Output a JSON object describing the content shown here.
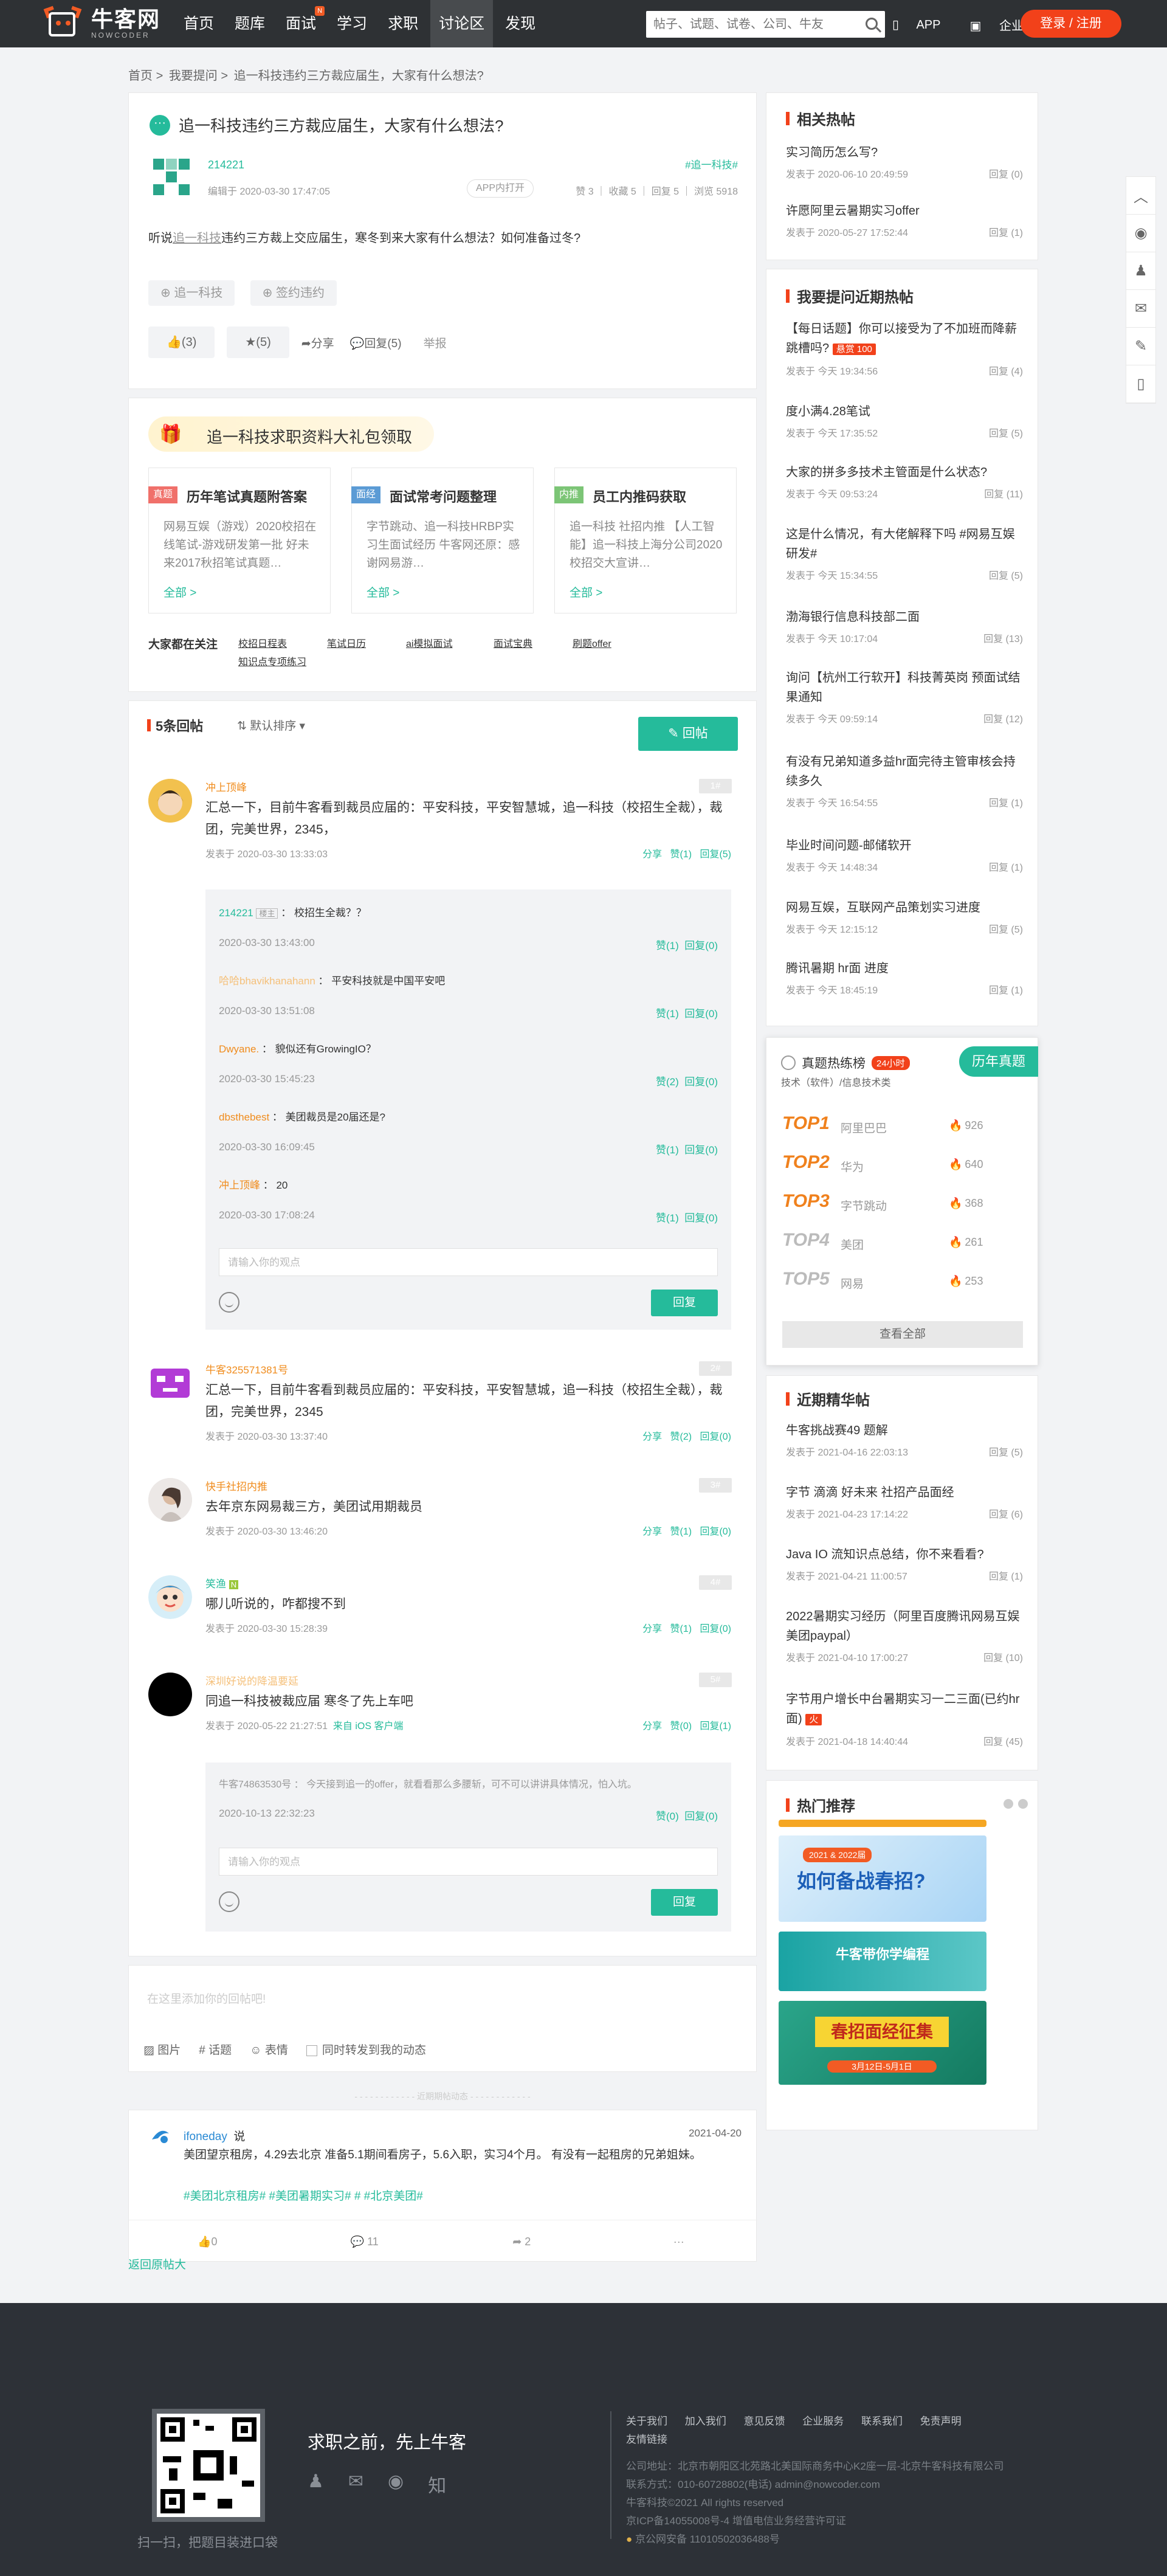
{
  "header": {
    "logo_cn": "牛客网",
    "logo_en": "NOWCODER",
    "nav": [
      {
        "label": "首页",
        "badge": ""
      },
      {
        "label": "题库",
        "badge": ""
      },
      {
        "label": "面试",
        "badge": "N"
      },
      {
        "label": "学习",
        "badge": ""
      },
      {
        "label": "求职",
        "badge": ""
      },
      {
        "label": "讨论区",
        "badge": ""
      },
      {
        "label": "发现",
        "badge": ""
      }
    ],
    "search_placeholder": "帖子、试题、试卷、公司、牛友",
    "app_label": "APP",
    "enterprise_label": "企业版",
    "login_label": "登录 / 注册"
  },
  "breadcrumb": [
    "首页",
    ">",
    "我要提问",
    ">",
    "追一科技违约三方裁应届生，大家有什么想法?"
  ],
  "post": {
    "title": "追一科技违约三方裁应届生，大家有什么想法?",
    "author": "214221",
    "edit_time": "编辑于 2020-03-30 17:47:05",
    "tag": "#追一科技#",
    "app_open": "APP内打开",
    "stats": "赞 3 ｜ 收藏 5 ｜ 回复 5 ｜ 浏览 5918",
    "body_prefix": "听说",
    "body_link": "追一科技",
    "body_suffix": "违约三方裁上交应届生，寒冬到来大家有什么想法？如何准备过冬?",
    "tags": [
      "追一科技",
      "签约违约"
    ],
    "like": "(3)",
    "star": "(5)",
    "share": "分享",
    "reply": "回复(5)",
    "report": "举报"
  },
  "gift": {
    "title": "追一科技求职资料大礼包领取",
    "cards": [
      {
        "label": "真题",
        "label_color": "#f0706a",
        "title": "历年笔试真题附答案",
        "desc": "网易互娱（游戏）2020校招在线笔试-游戏研发第一批 好未来2017秋招笔试真题…",
        "more": "全部 >"
      },
      {
        "label": "面经",
        "label_color": "#5b9bd5",
        "title": "面试常考问题整理",
        "desc": "字节跳动、追一科技HRBP实习生面试经历 牛客网还原：感谢网易游…",
        "more": "全部 >"
      },
      {
        "label": "内推",
        "label_color": "#7cc576",
        "title": "员工内推码获取",
        "desc": "追一科技 社招内推 【人工智能】追一科技上海分公司2020校招交大宣讲…",
        "more": "全部 >"
      }
    ],
    "follow_label": "大家都在关注",
    "keywords": [
      "校招日程表",
      "笔试日历",
      "ai模拟面试",
      "面试宝典",
      "刷题offer",
      "知识点专项练习"
    ]
  },
  "replies": {
    "count_label": "5条回帖",
    "sort_label": "默认排序",
    "reply_button": "回帖",
    "items": [
      {
        "nick": "冲上顶峰",
        "floor": "1#",
        "content": "汇总一下，目前牛客看到裁员应届的：平安科技，平安智慧城，追一科技（校招生全裁），裁团，完美世界，2345，",
        "time": "发表于 2020-03-30 13:33:03",
        "share": "分享",
        "likes": "赞(1)",
        "rep": "回复(5)"
      },
      {
        "nick": "牛客325571381号",
        "floor": "2#",
        "content": "汇总一下，目前牛客看到裁员应届的：平安科技，平安智慧城，追一科技（校招生全裁），裁团，完美世界，2345",
        "time": "发表于 2020-03-30 13:37:40",
        "share": "分享",
        "likes": "赞(2)",
        "rep": "回复(0)"
      },
      {
        "nick": "快手社招内推",
        "floor": "3#",
        "content": "去年京东网易裁三方，美团试用期裁员",
        "time": "发表于 2020-03-30 13:46:20",
        "share": "分享",
        "likes": "赞(1)",
        "rep": "回复(0)"
      },
      {
        "nick": "笑渔",
        "floor": "4#",
        "badge": "N",
        "content": "哪儿听说的，咋都搜不到",
        "time": "发表于 2020-03-30 15:28:39",
        "share": "分享",
        "likes": "赞(1)",
        "rep": "回复(0)"
      },
      {
        "nick": "深圳好说的降温要延",
        "floor": "5#",
        "content": "同追一科技被裁应届 寒冬了先上车吧",
        "time": "发表于 2020-05-22 21:27:51",
        "from": "来自 iOS 客户端",
        "share": "分享",
        "likes": "赞(0)",
        "rep": "回复(1)"
      }
    ],
    "sub_replies": [
      {
        "nick": "214221",
        "badge": "楼主",
        "text": "校招生全裁？？",
        "time": "2020-03-30 13:43:00",
        "likes": "赞(1)",
        "rep": "回复(0)"
      },
      {
        "nick": "哈哈bhavikhanahann",
        "badge": "",
        "text": "平安科技就是中国平安吧",
        "time": "2020-03-30 13:51:08",
        "likes": "赞(1)",
        "rep": "回复(0)"
      },
      {
        "nick": "Dwyane.",
        "badge": "",
        "text": "貌似还有GrowingIO？",
        "time": "2020-03-30 15:45:23",
        "likes": "赞(2)",
        "rep": "回复(0)"
      },
      {
        "nick": "dbsthebest",
        "badge": "",
        "text": "美团裁员是20届还是?",
        "time": "2020-03-30 16:09:45",
        "likes": "赞(1)",
        "rep": "回复(0)"
      },
      {
        "nick": "冲上顶峰",
        "badge": "",
        "text": "20",
        "time": "2020-03-30 17:08:24",
        "likes": "赞(1)",
        "rep": "回复(0)"
      }
    ],
    "sub_reply5": {
      "nick": "牛客74863530号",
      "text": "今天接到追一的offer，就看看那么多腰斩，可不可以讲讲具体情况，怕入坑。",
      "time": "2020-10-13 22:32:23",
      "likes": "赞(0)",
      "rep": "回复(0)"
    },
    "sub_placeholder": "请输入你的观点",
    "sub_reply_btn": "回复"
  },
  "composer": {
    "placeholder": "在这里添加你的回帖吧!",
    "image": "图片",
    "topic": "话题",
    "emoji": "表情",
    "repost": "同时转发到我的动态",
    "divider": "近期期帖动态"
  },
  "feed": {
    "nick": "ifoneday",
    "said": "说",
    "date": "2021-04-20",
    "text": "美团望京租房，4.29去北京 准备5.1期间看房子，5.6入职，实习4个月。 有没有一起租房的兄弟姐妹。",
    "tags": "#美团北京租房# #美团暑期实习# # #北京美团#",
    "likes": "0",
    "comments": "11",
    "shares": "2",
    "more": "···"
  },
  "back_link": "返回原帖大",
  "sidebar": {
    "hot_title": "相关热帖",
    "hot": [
      {
        "t": "实习简历怎么写?",
        "time": "发表于 2020-06-10 20:49:59",
        "rep": "回复 (0)"
      },
      {
        "t": "许愿阿里云暑期实习offer",
        "time": "发表于 2020-05-27 17:52:44",
        "rep": "回复 (1)"
      }
    ],
    "ask_title": "我要提问近期热帖",
    "ask": [
      {
        "t": "【每日话题】你可以接受为了不加班而降薪跳槽吗?",
        "badge": "悬赏 100",
        "time": "发表于 今天 19:34:56",
        "rep": "回复 (4)"
      },
      {
        "t": "度小满4.28笔试",
        "time": "发表于 今天 17:35:52",
        "rep": "回复 (5)"
      },
      {
        "t": "大家的拼多多技术主管面是什么状态?",
        "time": "发表于 今天 09:53:24",
        "rep": "回复 (11)"
      },
      {
        "t": "这是什么情况，有大佬解释下吗 #网易互娱研发#",
        "time": "发表于 今天 15:34:55",
        "rep": "回复 (5)"
      },
      {
        "t": "渤海银行信息科技部二面",
        "time": "发表于 今天 10:17:04",
        "rep": "回复 (13)"
      },
      {
        "t": "询问【杭州工行软开】科技菁英岗 预面试结果通知",
        "time": "发表于 今天 09:59:14",
        "rep": "回复 (12)"
      },
      {
        "t": "有没有兄弟知道多益hr面完待主管审核会持续多久",
        "time": "发表于 今天 16:54:55",
        "rep": "回复 (1)"
      },
      {
        "t": "毕业时间问题-邮储软开",
        "time": "发表于 今天 14:48:34",
        "rep": "回复 (1)"
      },
      {
        "t": "网易互娱，互联网产品策划实习进度",
        "time": "发表于 今天 12:15:12",
        "rep": "回复 (5)"
      },
      {
        "t": "腾讯暑期 hr面 进度",
        "time": "发表于 今天 18:45:19",
        "rep": "回复 (1)"
      }
    ],
    "rank": {
      "title": "真题热练榜",
      "badge": "24小时",
      "sub": "技术（软件）/信息技术类",
      "corner": "历年真题",
      "items": [
        {
          "n": "TOP1",
          "c": "阿里巴巴",
          "h": "926"
        },
        {
          "n": "TOP2",
          "c": "华为",
          "h": "640"
        },
        {
          "n": "TOP3",
          "c": "字节跳动",
          "h": "368"
        },
        {
          "n": "TOP4",
          "c": "美团",
          "h": "261"
        },
        {
          "n": "TOP5",
          "c": "网易",
          "h": "253"
        }
      ],
      "view_all": "查看全部"
    },
    "digest_title": "近期精华帖",
    "digest": [
      {
        "t": "牛客挑战赛49 题解",
        "time": "发表于 2021-04-16 22:03:13",
        "rep": "回复 (5)"
      },
      {
        "t": "字节 滴滴 好未来 社招产品面经",
        "time": "发表于 2021-04-23 17:14:22",
        "rep": "回复 (6)"
      },
      {
        "t": "Java IO 流知识点总结，你不来看看?",
        "time": "发表于 2021-04-21 11:00:57",
        "rep": "回复 (1)"
      },
      {
        "t": "2022暑期实习经历（阿里百度腾讯网易互娱美团paypal）",
        "time": "发表于 2021-04-10 17:00:27",
        "rep": "回复 (10)"
      },
      {
        "t": "字节用户增长中台暑期实习一二三面(已约hr面)",
        "badge": "火",
        "time": "发表于 2021-04-18 14:40:44",
        "rep": "回复 (45)"
      }
    ],
    "rec_title": "热门推荐",
    "banners": [
      {
        "text": "",
        "color": "#f5a623"
      },
      {
        "text": "如何备战春招?",
        "sub": "2021 & 2022届",
        "color": "#2a7fd8"
      },
      {
        "text": "牛客带你学编程",
        "color": "#1aa3a3"
      },
      {
        "text": "春招面经征集",
        "sub": "3月12日-5月1日",
        "color": "#1a8f6a"
      }
    ]
  },
  "footer": {
    "qr_caption": "扫一扫，把题目装进口袋",
    "slogan": "求职之前，先上牛客",
    "links": [
      "关于我们",
      "加入我们",
      "意见反馈",
      "企业服务",
      "联系我们",
      "免责声明",
      "友情链接"
    ],
    "address": "公司地址：北京市朝阳区北苑路北美国际商务中心K2座一层-北京牛客科技有限公司",
    "contact": "联系方式：010-60728802(电话)     admin@nowcoder.com",
    "copyright": "牛客科技©2021 All rights reserved",
    "icp": "京ICP备14055008号-4     增值电信业务经营许可证",
    "police": "京公网安备 11010502036488号"
  }
}
